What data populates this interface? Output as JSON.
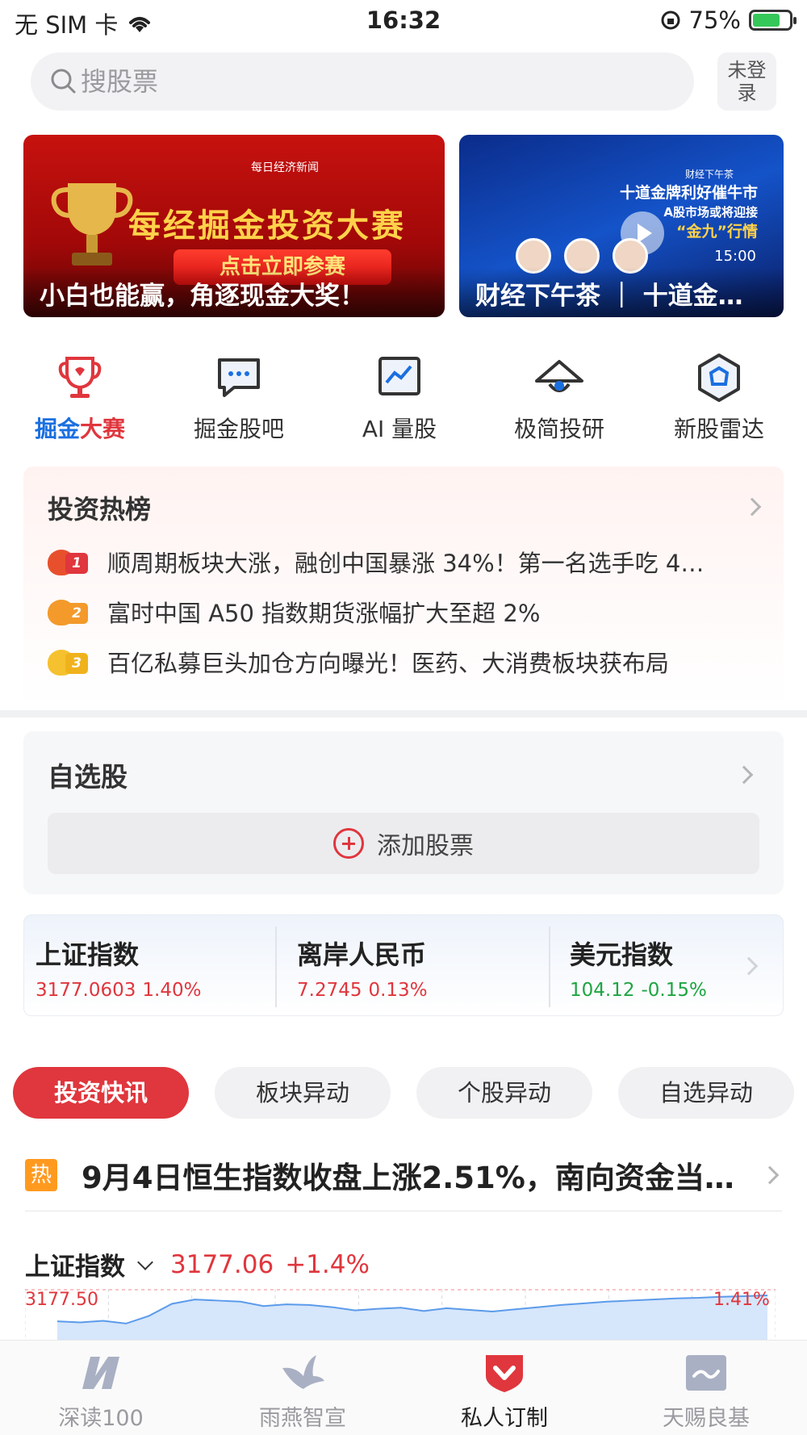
{
  "status_bar": {
    "carrier": "无 SIM 卡",
    "time": "16:32",
    "battery_percent": "75%",
    "battery_level": 0.75
  },
  "search": {
    "placeholder": "搜股票",
    "login_label": "未登录"
  },
  "banners": [
    {
      "caption": "小白也能赢，角逐现金大奖！",
      "logo_text": "每日经济新闻",
      "title": "每经掘金投资大赛",
      "cta": "点击立即参赛"
    },
    {
      "caption": "财经下午茶 ｜ 十道金…",
      "small": "财经下午茶",
      "title_line1": "十道金牌利好催牛市",
      "title_line2": "A股市场或将迎接",
      "title_line3": "“金九”行情",
      "time": "15:00"
    }
  ],
  "quick_nav": [
    {
      "label": "掘金大赛",
      "icon": "trophy-icon",
      "color": "#e0363d"
    },
    {
      "label": "掘金股吧",
      "icon": "chat-bubble-icon",
      "color": "#333333"
    },
    {
      "label": "AI 量股",
      "icon": "chart-monitor-icon",
      "color": "#333333"
    },
    {
      "label": "极简投研",
      "icon": "eye-lamp-icon",
      "color": "#333333"
    },
    {
      "label": "新股雷达",
      "icon": "hexagon-radar-icon",
      "color": "#333333"
    }
  ],
  "hot_list": {
    "title": "投资热榜",
    "items": [
      {
        "rank": "1",
        "text": "顺周期板块大涨，融创中国暴涨 34%！第一名选手吃 4…",
        "color": "#e8502d"
      },
      {
        "rank": "2",
        "text": "富时中国 A50 指数期货涨幅扩大至超 2%",
        "color": "#f39a2b"
      },
      {
        "rank": "3",
        "text": "百亿私募巨头加仓方向曝光！医药、大消费板块获布局",
        "color": "#f5c12e"
      }
    ]
  },
  "watchlist": {
    "title": "自选股",
    "add_label": "添加股票"
  },
  "indices": [
    {
      "name": "上证指数",
      "value": "3177.0603",
      "change": "1.40%",
      "trend": "up"
    },
    {
      "name": "离岸人民币",
      "value": "7.2745",
      "change": "0.13%",
      "trend": "up"
    },
    {
      "name": "美元指数",
      "value": "104.12",
      "change": "-0.15%",
      "trend": "down"
    }
  ],
  "tabs": [
    {
      "label": "投资快讯",
      "active": true
    },
    {
      "label": "板块异动",
      "active": false
    },
    {
      "label": "个股异动",
      "active": false
    },
    {
      "label": "自选异动",
      "active": false
    }
  ],
  "headline": {
    "tag": "热",
    "text": "9月4日恒生指数收盘上涨2.51%，南向资金当…"
  },
  "mini_chart": {
    "name": "上证指数",
    "price": "3177.06",
    "change": "+1.4%",
    "high_label": "3177.50",
    "high_pct_label": "1.41%"
  },
  "chart_data": {
    "type": "area",
    "title": "上证指数",
    "y_top_label": "3177.50",
    "right_top_label": "1.41%",
    "values": [
      3130,
      3128,
      3131,
      3126,
      3140,
      3162,
      3170,
      3168,
      3166,
      3158,
      3161,
      3160,
      3156,
      3150,
      3153,
      3155,
      3149,
      3154,
      3151,
      3148,
      3152,
      3156,
      3160,
      3163,
      3166,
      3168,
      3170,
      3172,
      3173,
      3175,
      3176,
      3177.5
    ]
  },
  "bottom_nav": [
    {
      "label": "深读100",
      "icon": "nbd-logo-icon",
      "active": false
    },
    {
      "label": "雨燕智宣",
      "icon": "swallow-icon",
      "active": false
    },
    {
      "label": "私人订制",
      "icon": "shield-check-icon",
      "active": true
    },
    {
      "label": "天赐良基",
      "icon": "trend-card-icon",
      "active": false
    }
  ],
  "colors": {
    "accent_red": "#e0363d",
    "down_green": "#1ea542",
    "brand_blue": "#1a6fe0"
  }
}
